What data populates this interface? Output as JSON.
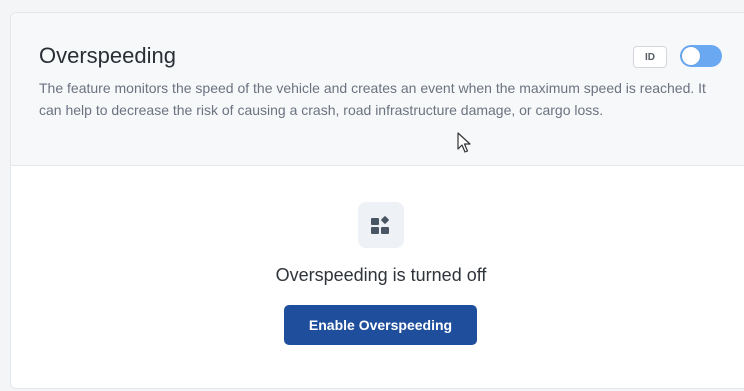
{
  "header": {
    "title": "Overspeeding",
    "description": "The feature monitors the speed of the vehicle and creates an event when the maximum speed is reached. It can help to decrease the risk of causing a crash, road infrastructure damage, or cargo loss.",
    "id_chip": "ID",
    "toggle_state": "off"
  },
  "body": {
    "icon": "feature-blocks-icon",
    "status": "Overspeeding is turned off",
    "enable_button_label": "Enable Overspeeding"
  },
  "colors": {
    "button": "#1f4f9c",
    "toggle": "#6aa9f2",
    "header_bg": "#f7f8fa"
  }
}
